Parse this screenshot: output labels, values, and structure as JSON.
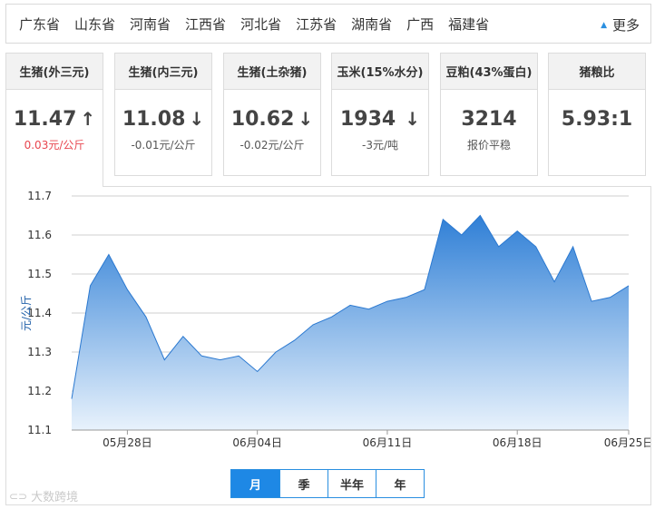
{
  "provinces": [
    "广东省",
    "山东省",
    "河南省",
    "江西省",
    "河北省",
    "江苏省",
    "湖南省",
    "广西",
    "福建省"
  ],
  "more_label": "更多",
  "cards": [
    {
      "title": "生猪(外三元)",
      "value": "11.47",
      "dir": "up",
      "change": "0.03元/公斤"
    },
    {
      "title": "生猪(内三元)",
      "value": "11.08",
      "dir": "down",
      "change": "-0.01元/公斤"
    },
    {
      "title": "生猪(土杂猪)",
      "value": "10.62",
      "dir": "down",
      "change": "-0.02元/公斤"
    },
    {
      "title": "玉米(15%水分)",
      "value": "1934",
      "dir": "down",
      "change": "-3元/吨"
    },
    {
      "title": "豆粕(43%蛋白)",
      "value": "3214",
      "dir": "none",
      "change": "报价平稳"
    },
    {
      "title": "猪粮比",
      "value": "5.93:1",
      "dir": "none",
      "change": ""
    }
  ],
  "colors": {
    "up": "#e8464f",
    "down": "#2eaa4c",
    "accent": "#1e88e5",
    "area_top": "#2f7fd6",
    "area_bottom": "#e8f2fc"
  },
  "range_tabs": [
    "月",
    "季",
    "半年",
    "年"
  ],
  "selected_range": "月",
  "watermark": "大数跨境",
  "chart_data": {
    "type": "area",
    "ylabel": "元/公斤",
    "ylim": [
      11.1,
      11.7
    ],
    "yticks": [
      "11.7",
      "11.6",
      "11.5",
      "11.4",
      "11.3",
      "11.2",
      "11.1"
    ],
    "xtick_labels": [
      "05月28日",
      "06月04日",
      "06月11日",
      "06月18日",
      "06月25日"
    ],
    "x_start": "05月25日",
    "x_end": "06月25日",
    "grid": true,
    "values": [
      11.18,
      11.47,
      11.55,
      11.46,
      11.39,
      11.28,
      11.34,
      11.29,
      11.28,
      11.29,
      11.25,
      11.3,
      11.33,
      11.37,
      11.39,
      11.42,
      11.41,
      11.43,
      11.44,
      11.46,
      11.64,
      11.6,
      11.65,
      11.57,
      11.61,
      11.57,
      11.48,
      11.57,
      11.43,
      11.44,
      11.47
    ]
  }
}
